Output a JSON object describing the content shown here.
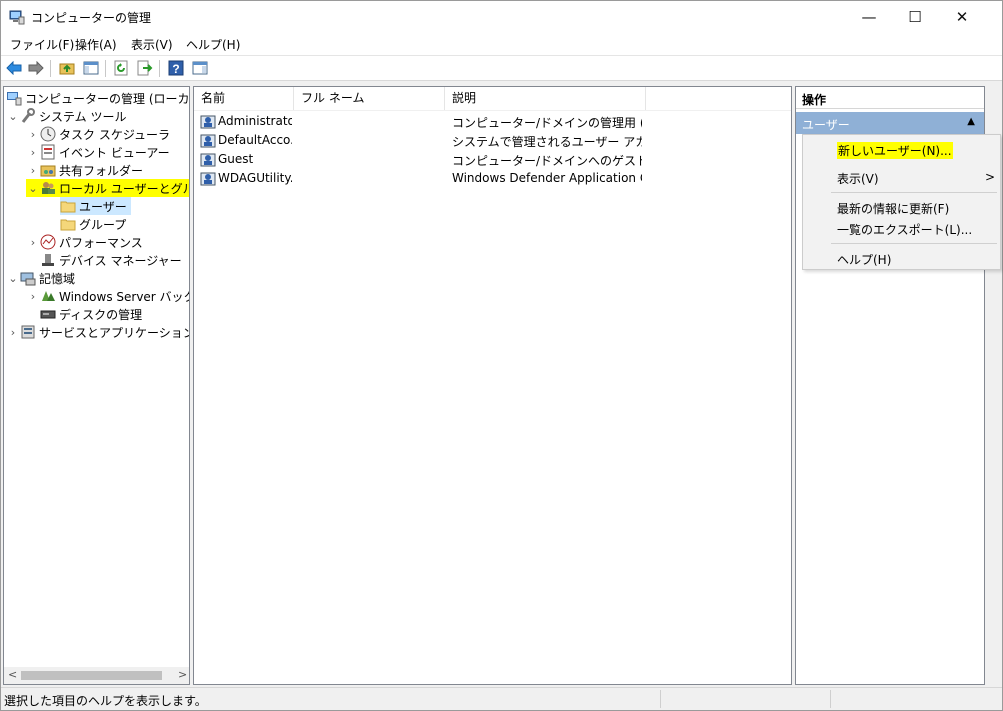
{
  "window": {
    "title": "コンピューターの管理",
    "minimize_glyph": "—",
    "maximize_glyph": "☐",
    "close_glyph": "✕"
  },
  "menu": [
    "ファイル(F)",
    "操作(A)",
    "表示(V)",
    "ヘルプ(H)"
  ],
  "toolbar": {
    "icons": [
      "back-arrow-icon",
      "forward-arrow-icon",
      "up-folder-icon",
      "show-hide-tree-icon",
      "refresh-icon",
      "export-list-icon",
      "help-icon",
      "show-hide-action-pane-icon"
    ]
  },
  "tree": {
    "root": "コンピューターの管理 (ローカル)",
    "system_tools": "システム ツール",
    "task_scheduler": "タスク スケジューラ",
    "event_viewer": "イベント ビューアー",
    "shared_folders": "共有フォルダー",
    "local_users_groups": "ローカル ユーザーとグループ",
    "users": "ユーザー",
    "groups": "グループ",
    "performance": "パフォーマンス",
    "device_manager": "デバイス マネージャー",
    "storage": "記憶域",
    "windows_server_backup": "Windows Server バックア",
    "disk_management": "ディスクの管理",
    "services_apps": "サービスとアプリケーション",
    "scroll_left": "<",
    "scroll_right": ">"
  },
  "list": {
    "columns": [
      "名前",
      "フル ネーム",
      "説明"
    ],
    "rows": [
      {
        "name": "Administrator",
        "full_name": "",
        "description": "コンピューター/ドメインの管理用 (ビルト..."
      },
      {
        "name": "DefaultAcco...",
        "full_name": "",
        "description": "システムで管理されるユーザー アカウン..."
      },
      {
        "name": "Guest",
        "full_name": "",
        "description": "コンピューター/ドメインへのゲスト アクセ..."
      },
      {
        "name": "WDAGUtility...",
        "full_name": "",
        "description": "Windows Defender Application G..."
      }
    ]
  },
  "actions": {
    "header": "操作",
    "section": "ユーザー",
    "section_glyph": "▲"
  },
  "context_menu": {
    "new_user": "新しいユーザー(N)...",
    "view": "表示(V)",
    "view_arrow": ">",
    "refresh": "最新の情報に更新(F)",
    "export": "一覧のエクスポート(L)...",
    "help": "ヘルプ(H)"
  },
  "status": {
    "text": "選択した項目のヘルプを表示します。"
  },
  "colors": {
    "highlight": "#ffff00",
    "action_section_bg": "#8fb0d6",
    "selected_bg": "#cce8ff"
  }
}
